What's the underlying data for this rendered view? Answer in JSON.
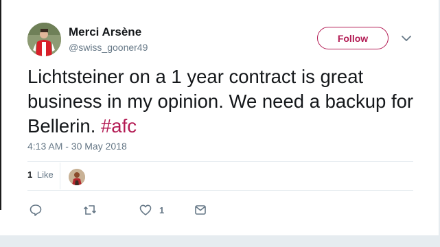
{
  "author": {
    "display_name": "Merci Arsène",
    "handle": "@swiss_gooner49"
  },
  "follow_button": {
    "label": "Follow"
  },
  "tweet": {
    "text": "Lichtsteiner on a 1 year contract is great business in my opinion. We need a backup for Bellerin. ",
    "hashtag": "#afc",
    "timestamp": "4:13 AM - 30 May 2018"
  },
  "stats": {
    "like_count": "1",
    "like_label": "Like"
  },
  "actions": {
    "like_count": "1",
    "icons": [
      "reply-icon",
      "retweet-icon",
      "heart-icon",
      "direct-message-icon"
    ]
  },
  "colors": {
    "accent": "#b31b54",
    "text_primary": "#14171a",
    "text_secondary": "#657786",
    "divider": "#e6ecf0",
    "page_background": "#e6ecf0"
  }
}
